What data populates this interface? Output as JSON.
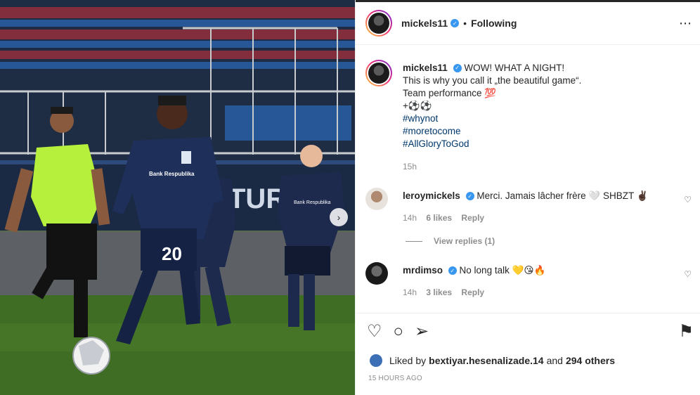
{
  "post": {
    "username": "mickels11",
    "follow_state": "Following",
    "caption_lines": [
      "WOW! WHAT A NIGHT!",
      "This is why you call it „the beautiful game“.",
      "Team performance 💯",
      "+⚽⚽"
    ],
    "hashtags": [
      "#whynot",
      "#moretocome",
      "#AllGloryToGod"
    ],
    "caption_time": "15h"
  },
  "comments": [
    {
      "username": "leroymickels",
      "text": "Merci. Jamais lâcher frère 🤍 SHBZT ✌🏿",
      "time": "14h",
      "likes": "6 likes",
      "reply": "Reply",
      "view_replies": "View replies (1)"
    },
    {
      "username": "mrdimso",
      "text": "No long talk 💛😘🔥",
      "time": "14h",
      "likes": "3 likes",
      "reply": "Reply"
    }
  ],
  "likes": {
    "prefix": "Liked by",
    "user": "bextiyar.hesenalizade.14",
    "middle": "and",
    "others": "294 others"
  },
  "posted": "15 HOURS AGO",
  "icons": {
    "more": "⋯",
    "heart": "♡",
    "comment": "○",
    "share": "➢",
    "bookmark": "⚑",
    "next": "›",
    "verified": "✓"
  },
  "photo": {
    "player_number": "20",
    "jersey_sponsor": "Bank Respublika",
    "board_text": "TURK"
  },
  "colors": {
    "verified": "#3897f0",
    "hashtag": "#00376b",
    "muted": "#8e8e8e"
  }
}
